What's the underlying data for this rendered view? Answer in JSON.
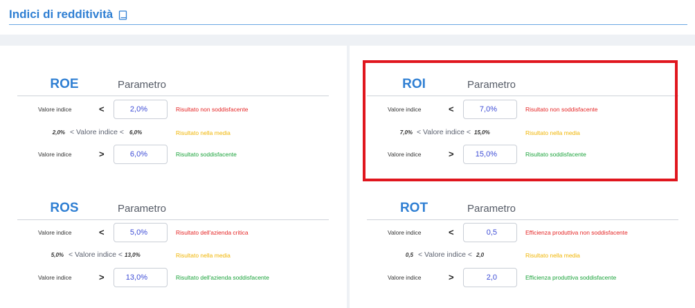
{
  "header": {
    "title": "Indici di redditività",
    "icon": "book-icon"
  },
  "colors": {
    "accent": "#2f7fd3",
    "bad": "#e52525",
    "average": "#f0b400",
    "good": "#1aa33a",
    "highlight": "#e0161e",
    "value": "#3c4bd6"
  },
  "blocks": {
    "roe": {
      "title": "ROE",
      "param": "Parametro",
      "low": {
        "label": "Valore indice",
        "op": "<",
        "value": "2,0%",
        "result": "Risultato non soddisfacente"
      },
      "mid": {
        "low": "2,0%",
        "label": "< Valore indice <",
        "high": "6,0%",
        "result": "Risultato nella media"
      },
      "high": {
        "label": "Valore indice",
        "op": ">",
        "value": "6,0%",
        "result": "Risultato soddisfacente"
      }
    },
    "roi": {
      "title": "ROI",
      "param": "Parametro",
      "low": {
        "label": "Valore indice",
        "op": "<",
        "value": "7,0%",
        "result": "Risultato non soddisfacente"
      },
      "mid": {
        "low": "7,0%",
        "label": "< Valore indice <",
        "high": "15,0%",
        "result": "Risultato nella media"
      },
      "high": {
        "label": "Valore indice",
        "op": ">",
        "value": "15,0%",
        "result": "Risultato soddisfacente"
      }
    },
    "ros": {
      "title": "ROS",
      "param": "Parametro",
      "low": {
        "label": "Valore indice",
        "op": "<",
        "value": "5,0%",
        "result": "Risultato dell'azienda critica"
      },
      "mid": {
        "low": "5,0%",
        "label": "< Valore indice <",
        "high": "13,0%",
        "result": "Risultato nella media"
      },
      "high": {
        "label": "Valore indice",
        "op": ">",
        "value": "13,0%",
        "result": "Risultato dell'azienda soddisfacente"
      }
    },
    "rot": {
      "title": "ROT",
      "param": "Parametro",
      "low": {
        "label": "Valore indice",
        "op": "<",
        "value": "0,5",
        "result": "Efficienza produttiva non soddisfacente"
      },
      "mid": {
        "low": "0,5",
        "label": "< Valore indice <",
        "high": "2,0",
        "result": "Risultato nella media"
      },
      "high": {
        "label": "Valore indice",
        "op": ">",
        "value": "2,0",
        "result": "Efficienza produttiva soddisfacente"
      }
    }
  }
}
